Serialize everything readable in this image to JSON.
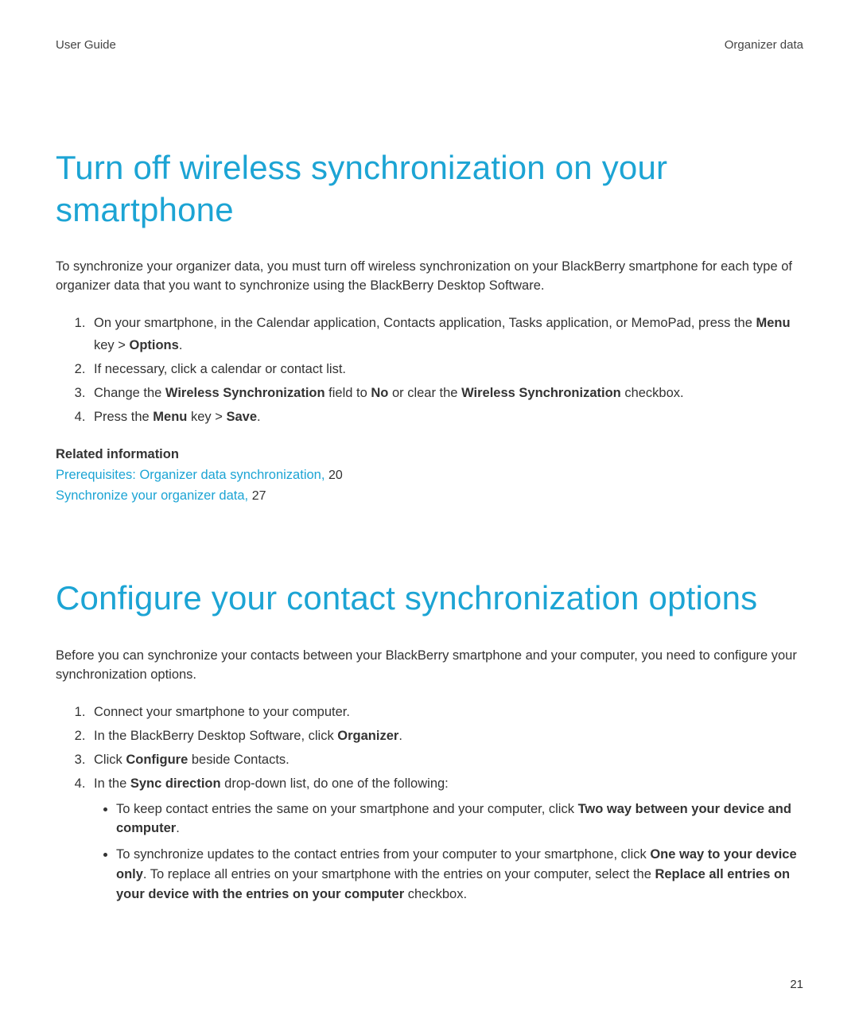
{
  "header": {
    "left": "User Guide",
    "right": "Organizer data"
  },
  "section1": {
    "title": "Turn off wireless synchronization on your smartphone",
    "intro": "To synchronize your organizer data, you must turn off wireless synchronization on your BlackBerry smartphone for each type of organizer data that you want to synchronize using the BlackBerry Desktop Software.",
    "step1_a": "On your smartphone, in the Calendar application, Contacts application, Tasks application, or MemoPad, press the ",
    "step1_b": "Menu",
    "step1_c": " key > ",
    "step1_d": "Options",
    "step1_e": ".",
    "step2": "If necessary, click a calendar or contact list.",
    "step3_a": "Change the ",
    "step3_b": "Wireless Synchronization",
    "step3_c": " field to ",
    "step3_d": "No",
    "step3_e": " or clear the ",
    "step3_f": "Wireless Synchronization",
    "step3_g": " checkbox.",
    "step4_a": "Press the ",
    "step4_b": "Menu",
    "step4_c": " key > ",
    "step4_d": "Save",
    "step4_e": ".",
    "related_heading": "Related information",
    "link1_text": "Prerequisites: Organizer data synchronization, ",
    "link1_page": "20",
    "link2_text": "Synchronize your organizer data, ",
    "link2_page": "27"
  },
  "section2": {
    "title": "Configure your contact synchronization options",
    "intro": "Before you can synchronize your contacts between your BlackBerry smartphone and your computer, you need to configure your synchronization options.",
    "step1": "Connect your smartphone to your computer.",
    "step2_a": "In the BlackBerry Desktop Software, click ",
    "step2_b": "Organizer",
    "step2_c": ".",
    "step3_a": "Click ",
    "step3_b": "Configure",
    "step3_c": " beside Contacts.",
    "step4_a": "In the ",
    "step4_b": "Sync direction",
    "step4_c": " drop-down list, do one of the following:",
    "bullet1_a": "To keep contact entries the same on your smartphone and your computer, click ",
    "bullet1_b": "Two way between your device and computer",
    "bullet1_c": ".",
    "bullet2_a": "To synchronize updates to the contact entries from your computer to your smartphone, click ",
    "bullet2_b": "One way to your device only",
    "bullet2_c": ". To replace all entries on your smartphone with the entries on your computer, select the ",
    "bullet2_d": "Replace all entries on your device with the entries on your computer",
    "bullet2_e": " checkbox."
  },
  "page_number": "21"
}
